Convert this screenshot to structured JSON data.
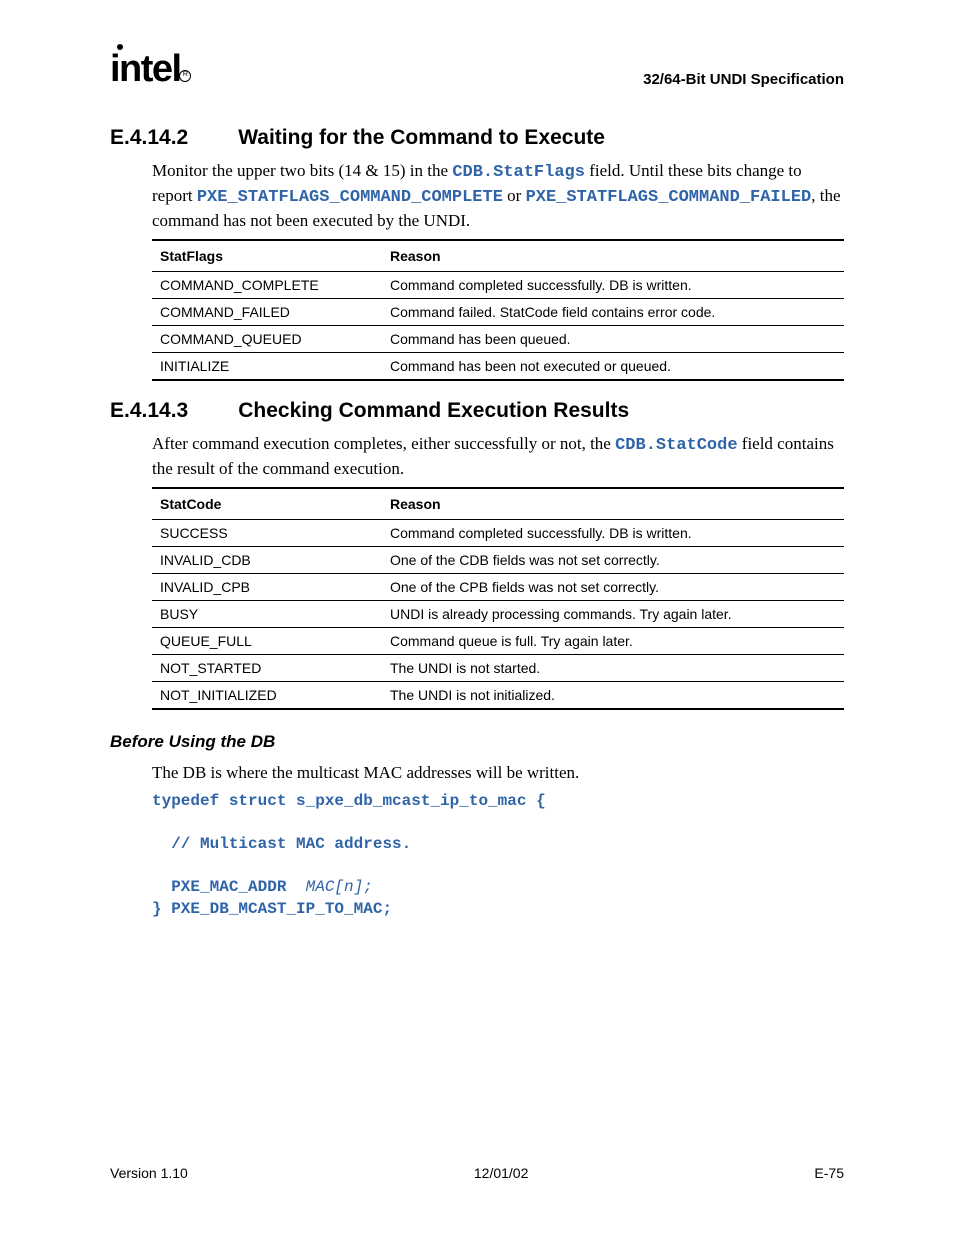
{
  "header": {
    "logo_text": "intel",
    "doc_title": "32/64-Bit UNDI Specification"
  },
  "section1": {
    "number": "E.4.14.2",
    "title": "Waiting for the Command to Execute",
    "para_parts": {
      "p1": "Monitor the upper two bits (14 & 15) in the ",
      "code1": "CDB.StatFlags",
      "p2": " field.  Until these bits change to report ",
      "code2": "PXE_STATFLAGS_COMMAND_COMPLETE",
      "p3": " or ",
      "code3": "PXE_STATFLAGS_COMMAND_FAILED",
      "p4": ", the command has not been executed by the UNDI."
    },
    "table": {
      "headers": [
        "StatFlags",
        "Reason"
      ],
      "rows": [
        [
          "COMMAND_COMPLETE",
          "Command completed successfully.  DB is written."
        ],
        [
          "COMMAND_FAILED",
          "Command failed.  StatCode field contains error code."
        ],
        [
          "COMMAND_QUEUED",
          "Command has been queued."
        ],
        [
          "INITIALIZE",
          "Command has been not executed or queued."
        ]
      ]
    }
  },
  "section2": {
    "number": "E.4.14.3",
    "title": "Checking Command Execution Results",
    "para_parts": {
      "p1": "After command execution completes, either successfully or not, the ",
      "code1": "CDB.StatCode",
      "p2": " field contains the result of the command execution."
    },
    "table": {
      "headers": [
        "StatCode",
        "Reason"
      ],
      "rows": [
        [
          "SUCCESS",
          "Command completed successfully.  DB is written."
        ],
        [
          "INVALID_CDB",
          "One of the CDB fields was not set correctly."
        ],
        [
          "INVALID_CPB",
          "One of the CPB fields was not set correctly."
        ],
        [
          "BUSY",
          "UNDI is already processing commands.  Try again later."
        ],
        [
          "QUEUE_FULL",
          "Command queue is full.  Try again later."
        ],
        [
          "NOT_STARTED",
          "The UNDI is not started."
        ],
        [
          "NOT_INITIALIZED",
          "The UNDI is not initialized."
        ]
      ]
    }
  },
  "section3": {
    "title": "Before Using the DB",
    "para": "The DB is where the multicast MAC addresses will be written.",
    "code": {
      "l1": "typedef struct s_pxe_db_mcast_ip_to_mac {",
      "l2": "",
      "l3": "  // Multicast MAC address.",
      "l4": "",
      "l5a": "  PXE_MAC_ADDR  ",
      "l5b": "MAC[n];",
      "l6": "} PXE_DB_MCAST_IP_TO_MAC;"
    }
  },
  "footer": {
    "left": "Version 1.10",
    "center": "12/01/02",
    "right": "E-75"
  }
}
